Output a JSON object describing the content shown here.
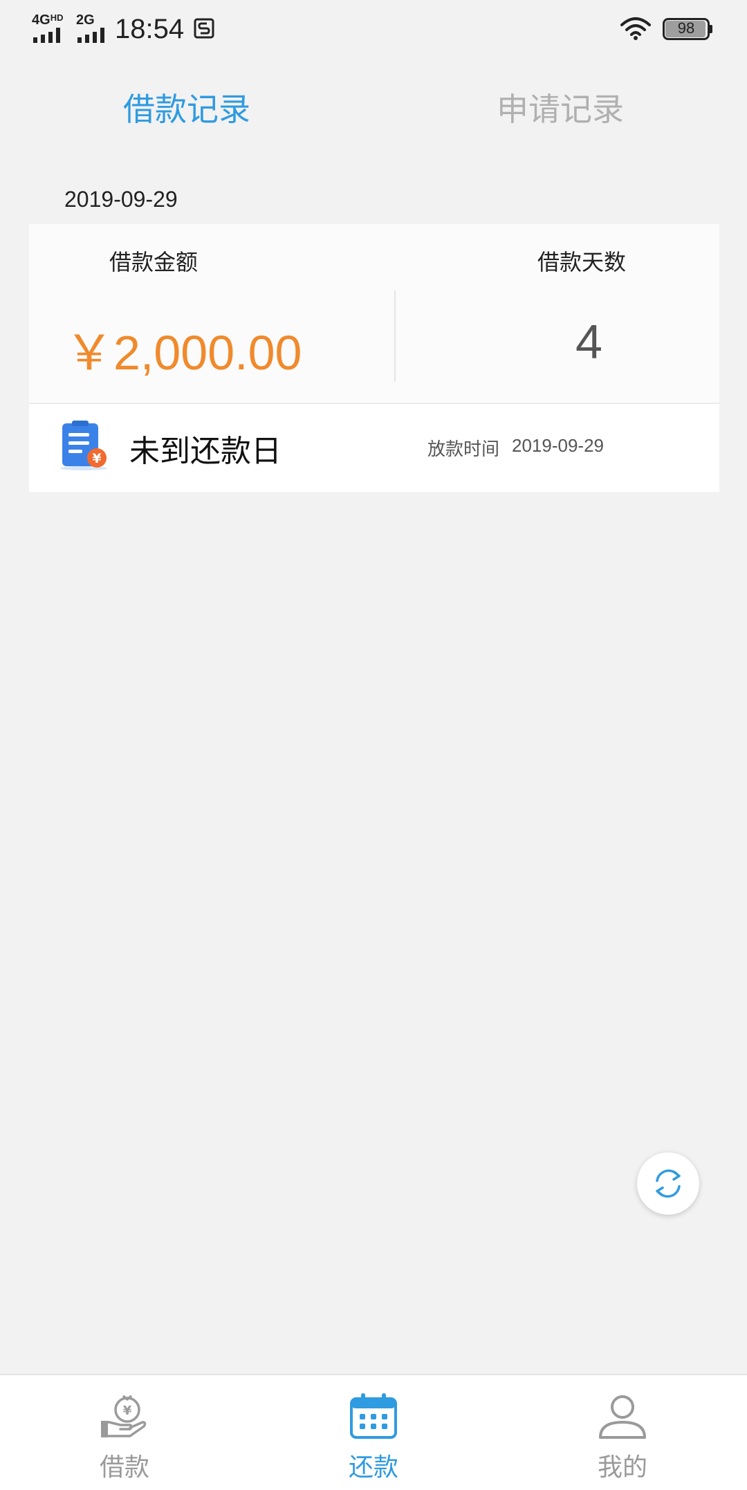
{
  "status_bar": {
    "network_1": "4G",
    "network_1_sup": "HD",
    "network_2": "2G",
    "time": "18:54",
    "battery": "98"
  },
  "tabs": [
    {
      "label": "借款记录",
      "active": true
    },
    {
      "label": "申请记录",
      "active": false
    }
  ],
  "record": {
    "date": "2019-09-29",
    "amount_label": "借款金额",
    "days_label": "借款天数",
    "amount": "￥2,000.00",
    "days": "4",
    "status": "未到还款日",
    "disburse_label": "放款时间",
    "disburse_date": "2019-09-29"
  },
  "colors": {
    "accent": "#2f9be0",
    "amount": "#f08a2c",
    "background": "#f2f2f2"
  },
  "bottom_nav": [
    {
      "label": "借款",
      "icon": "money-bag-hand-icon",
      "active": false
    },
    {
      "label": "还款",
      "icon": "calendar-icon",
      "active": true
    },
    {
      "label": "我的",
      "icon": "user-icon",
      "active": false
    }
  ]
}
